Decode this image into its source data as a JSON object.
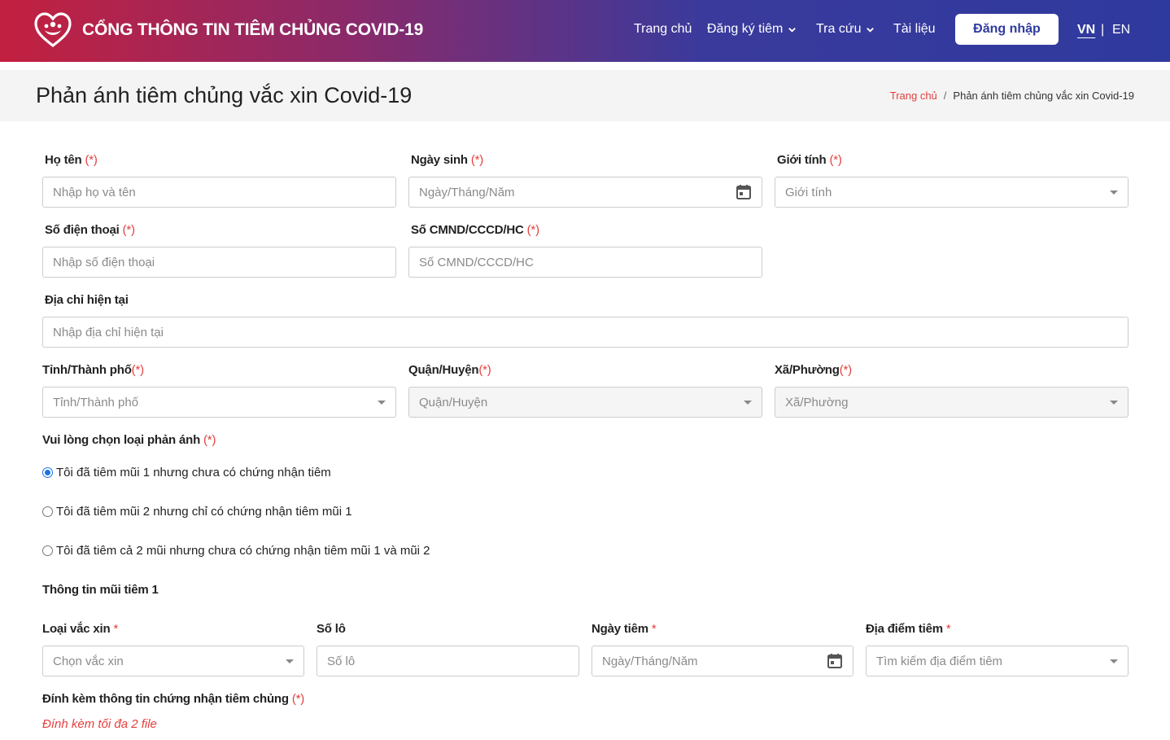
{
  "header": {
    "site_title": "CỔNG THÔNG TIN TIÊM CHỦNG COVID-19",
    "nav": [
      {
        "label": "Trang chủ"
      },
      {
        "label": "Đăng ký tiêm"
      },
      {
        "label": "Tra cứu"
      },
      {
        "label": "Tài liệu"
      }
    ],
    "login_label": "Đăng nhập",
    "lang_vn": "VN",
    "lang_sep": "|",
    "lang_en": "EN"
  },
  "titlebar": {
    "title": "Phản ánh tiêm chủng vắc xin Covid-19",
    "breadcrumb_home": "Trang chủ",
    "breadcrumb_sep": "/",
    "breadcrumb_current": "Phản ánh tiêm chủng vắc xin Covid-19"
  },
  "form": {
    "required_mark": "(*)",
    "required_star": "*",
    "full_name": {
      "label": "Họ tên",
      "placeholder": "Nhập họ và tên"
    },
    "dob": {
      "label": "Ngày sinh",
      "placeholder": "Ngày/Tháng/Năm"
    },
    "gender": {
      "label": "Giới tính",
      "placeholder": "Giới tính"
    },
    "phone": {
      "label": "Số điện thoại",
      "placeholder": "Nhập số điện thoại"
    },
    "id_number": {
      "label": "Số CMND/CCCD/HC",
      "placeholder": "Số CMND/CCCD/HC"
    },
    "address": {
      "label": "Địa chỉ hiện tại",
      "placeholder": "Nhập địa chỉ hiện tại"
    },
    "province": {
      "label": "Tỉnh/Thành phố",
      "placeholder": "Tỉnh/Thành phố"
    },
    "district": {
      "label": "Quận/Huyện",
      "placeholder": "Quận/Huyện"
    },
    "ward": {
      "label": "Xã/Phường",
      "placeholder": "Xã/Phường"
    },
    "feedback_type": {
      "label": "Vui lòng chọn loại phản ánh",
      "options": [
        {
          "label": "Tôi đã tiêm mũi 1 nhưng chưa có chứng nhận tiêm",
          "checked": true
        },
        {
          "label": "Tôi đã tiêm mũi 2 nhưng chỉ có chứng nhận tiêm mũi 1",
          "checked": false
        },
        {
          "label": "Tôi đã tiêm cả 2 mũi nhưng chưa có chứng nhận tiêm mũi 1 và mũi 2",
          "checked": false
        }
      ]
    },
    "dose1_section_title": "Thông tin mũi tiêm 1",
    "vaccine_type": {
      "label": "Loại vắc xin",
      "placeholder": "Chọn vắc xin"
    },
    "lot_number": {
      "label": "Số lô",
      "placeholder": "Số lô"
    },
    "injection_date": {
      "label": "Ngày tiêm",
      "placeholder": "Ngày/Tháng/Năm"
    },
    "injection_place": {
      "label": "Địa điểm tiêm",
      "placeholder": "Tìm kiếm địa điểm tiêm"
    },
    "attachment": {
      "label": "Đính kèm thông tin chứng nhận tiêm chủng",
      "note": "Đính kèm tối đa 2 file"
    }
  }
}
